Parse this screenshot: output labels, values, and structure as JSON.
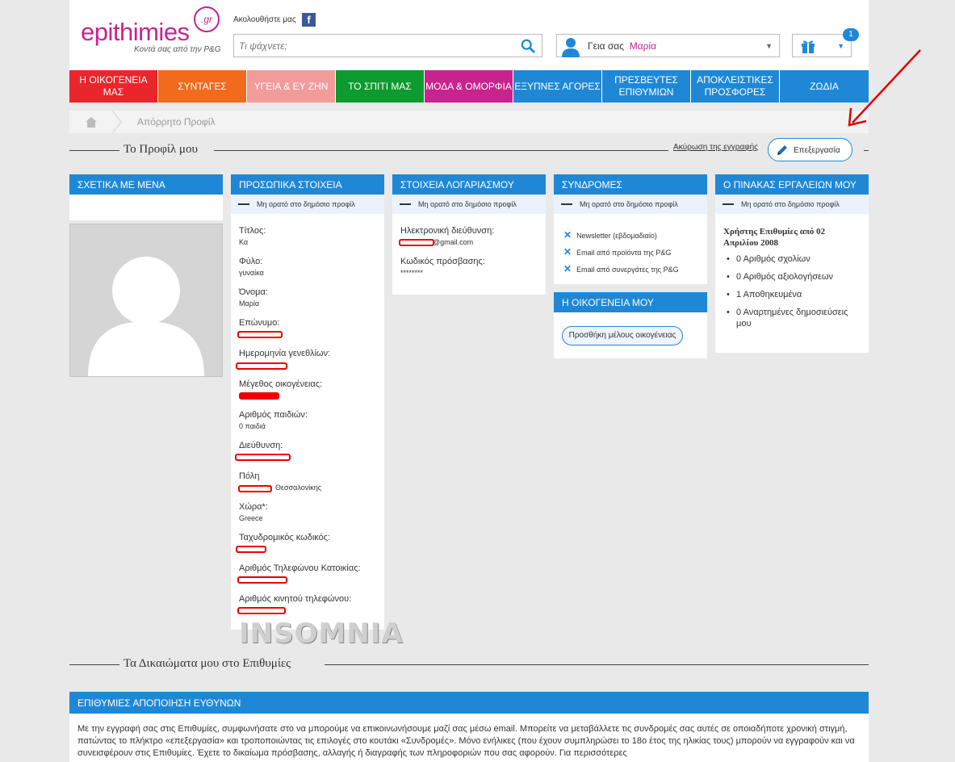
{
  "header": {
    "logo_text": "epithimies",
    "logo_badge": ".gr",
    "logo_tagline": "Κοντά σας από την P&G",
    "follow_label": "Ακολουθήστε μας",
    "facebook_glyph": "f",
    "search_placeholder": "Τι ψάχνετε;",
    "greeting": "Γεια σας",
    "user_name": "Μαρία",
    "gift_count": "1"
  },
  "nav": {
    "items": [
      {
        "label": "Η ΟΙΚΟΓΕΝΕΙΑ ΜΑΣ",
        "color": "#e8262b"
      },
      {
        "label": "ΣΥΝΤΑΓΕΣ",
        "color": "#f26a1b"
      },
      {
        "label": "ΥΓΕΙΑ & ΕΥ ΖΗΝ",
        "color": "#f29b9b"
      },
      {
        "label": "ΤΟ ΣΠΙΤΙ ΜΑΣ",
        "color": "#0d9a2f"
      },
      {
        "label": "ΜΟΔΑ & ΟΜΟΡΦΙΑ",
        "color": "#c8238e"
      },
      {
        "label": "ΕΞΥΠΝΕΣ ΑΓΟΡΕΣ",
        "color": "#1e88d6"
      },
      {
        "label": "ΠΡΕΣΒΕΥΤΕΣ ΕΠΙΘΥΜΙΩΝ",
        "color": "#1e88d6"
      },
      {
        "label": "ΑΠΟΚΛΕΙΣΤΙΚΕΣ ΠΡΟΣΦΟΡΕΣ",
        "color": "#1e88d6"
      },
      {
        "label": "ΖΩΔΙΑ",
        "color": "#1e88d6"
      }
    ]
  },
  "breadcrumb": {
    "current": "Απόρρητο Προφίλ"
  },
  "profile_section": {
    "title": "Το Προφίλ μου",
    "cancel_link": "Ακύρωση της εγγραφής",
    "edit_button": "Επεξεργασία"
  },
  "private_note": "Μη ορατό στο δημόσιο προφίλ",
  "about_me": {
    "title": "ΣΧΕΤΙΚΑ ΜΕ ΜΕΝΑ"
  },
  "personal": {
    "title": "ΠΡΟΣΩΠΙΚΑ ΣΤΟΙΧΕΙΑ",
    "fields": [
      {
        "label": "Τίτλος:",
        "value": "Κα"
      },
      {
        "label": "Φύλο:",
        "value": "γυναίκα"
      },
      {
        "label": "Όνομα:",
        "value": "Μαρία"
      },
      {
        "label": "Επώνυμο:",
        "value": ""
      },
      {
        "label": "Ημερομηνία γενεθλίων:",
        "value": ""
      },
      {
        "label": "Μέγεθος οικογένειας:",
        "value": ""
      },
      {
        "label": "Αριθμός παιδιών:",
        "value": "0 παιδιά"
      },
      {
        "label": "Διεύθυνση:",
        "value": ""
      },
      {
        "label": "Πόλη",
        "value": "Θεσσαλονίκης"
      },
      {
        "label": "Χώρα*:",
        "value": "Greece"
      },
      {
        "label": "Ταχυδρομικός κωδικός:",
        "value": ""
      },
      {
        "label": "Αριθμός Τηλεφώνου Κατοικίας:",
        "value": ""
      },
      {
        "label": "Αριθμός κινητού τηλεφώνου:",
        "value": ""
      }
    ]
  },
  "account": {
    "title": "ΣΤΟΙΧΕΙΑ ΛΟΓΑΡΙΑΣΜΟΥ",
    "email_label": "Ηλεκτρονική διεύθυνση:",
    "email_value": "@gmail.com",
    "password_label": "Κωδικός πρόσβασης:",
    "password_value": "********"
  },
  "subscriptions": {
    "title": "ΣΥΝΔΡΟΜΕΣ",
    "items": [
      "Newsletter (εβδομαδιαίο)",
      "Email από προϊόντα της P&G",
      "Email από συνεργάτες της P&G"
    ]
  },
  "family": {
    "title": "Η ΟΙΚΟΓΕΝΕΙΑ ΜΟΥ",
    "add_button": "Προσθήκη μέλους οικογένειας"
  },
  "tools": {
    "title": "Ο ΠΙΝΑΚΑΣ ΕΡΓΑΛΕΙΩΝ ΜΟΥ",
    "member_since": "Χρήστης Επιθυμίες από 02 Απριλίου 2008",
    "stats": [
      "0 Αριθμός σχολίων",
      "0 Αριθμός αξιολογήσεων",
      "1 Αποθηκευμένα",
      "0 Αναρτημένες δημοσιεύσεις μου"
    ]
  },
  "watermark": "INSOMNIA",
  "rights_section": {
    "title": "Τα Δικαιώματα μου στο Επιθυμίες",
    "box_title": "ΕΠΙΘΥΜΙΕΣ ΑΠΟΠΟΙΗΣΗ ΕΥΘΥΝΩΝ",
    "text": "Με την εγγραφή σας στις Επιθυμίες, συμφωνήσατε στο να μπορούμε να επικοινωνήσουμε μαζί σας μέσω email. Μπορείτε να μεταβάλλετε τις συνδρομές σας αυτές σε οποιαδήποτε χρονική στιγμή, πατώντας το πλήκτρο «επεξεργασία» και τροποποιώντας τις επιλογές στο κουτάκι «Συνδρομές». Μόνο ενήλικες (που έχουν συμπληρώσει το 18ο έτος της ηλικίας τους) μπορούν να εγγραφούν και να συνεισφέρουν στις Επιθυμίες. Έχετε το δικαίωμα πρόσβασης, αλλαγής ή διαγραφής των πληροφοριών που σας αφορούν. Για περισσότερες"
  },
  "colors": {
    "brand": "#c8238e",
    "accent": "#1e88d6",
    "annotation_arrow": "#e00000"
  }
}
